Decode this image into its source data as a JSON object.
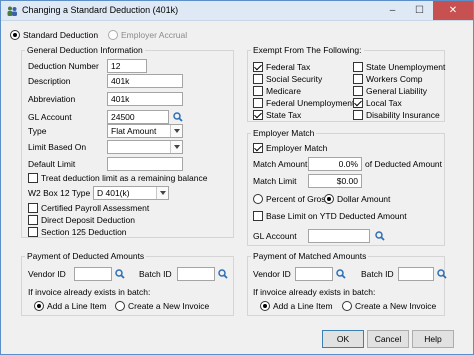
{
  "window": {
    "title": "Changing a Standard Deduction  (401k)"
  },
  "mode": {
    "standard": "Standard Deduction",
    "employer": "Employer Accrual"
  },
  "general": {
    "title": "General Deduction Information",
    "deduction_number_label": "Deduction Number",
    "deduction_number": "12",
    "description_label": "Description",
    "description": "401k",
    "abbreviation_label": "Abbreviation",
    "abbreviation": "401k",
    "gl_account_label": "GL Account",
    "gl_account": "24500",
    "type_label": "Type",
    "type": "Flat Amount",
    "limit_based_on_label": "Limit Based On",
    "limit_based_on": "",
    "default_limit_label": "Default Limit",
    "default_limit": "",
    "treat_remaining_label": "Treat deduction limit as a remaining balance",
    "w2_label": "W2 Box 12 Type",
    "w2_value": "D  401(k)",
    "certified_label": "Certified Payroll Assessment",
    "direct_deposit_label": "Direct Deposit Deduction",
    "section125_label": "Section 125 Deduction"
  },
  "exempt": {
    "title": "Exempt From The Following:",
    "items": [
      {
        "label": "Federal Tax",
        "checked": true
      },
      {
        "label": "State Unemployment",
        "checked": false
      },
      {
        "label": "Social Security",
        "checked": false
      },
      {
        "label": "Workers Comp",
        "checked": false
      },
      {
        "label": "Medicare",
        "checked": false
      },
      {
        "label": "General Liability",
        "checked": false
      },
      {
        "label": "Federal Unemployment",
        "checked": false
      },
      {
        "label": "Local Tax",
        "checked": true
      },
      {
        "label": "State Tax",
        "checked": true
      },
      {
        "label": "Disability Insurance",
        "checked": false
      }
    ]
  },
  "match": {
    "title": "Employer Match",
    "employer_match_label": "Employer Match",
    "match_amount_label": "Match Amount",
    "match_amount": "0.0%",
    "of_deducted_label": "of Deducted Amount",
    "match_limit_label": "Match Limit",
    "match_limit": "$0.00",
    "percent_gross_label": "Percent of Gross",
    "dollar_amount_label": "Dollar Amount",
    "base_limit_label": "Base Limit on YTD Deducted Amount",
    "gl_account_label": "GL Account",
    "gl_account": ""
  },
  "payment_deducted": {
    "title": "Payment of Deducted Amounts",
    "vendor_label": "Vendor ID",
    "vendor": "",
    "batch_label": "Batch ID",
    "batch": "",
    "if_exists_label": "If invoice already exists in batch:",
    "add_line_label": "Add a Line Item",
    "create_invoice_label": "Create a New Invoice"
  },
  "payment_matched": {
    "title": "Payment of Matched Amounts",
    "vendor_label": "Vendor ID",
    "vendor": "",
    "batch_label": "Batch ID",
    "batch": "",
    "if_exists_label": "If invoice already exists in batch:",
    "add_line_label": "Add a Line Item",
    "create_invoice_label": "Create a New Invoice"
  },
  "buttons": {
    "ok": "OK",
    "cancel": "Cancel",
    "help": "Help"
  },
  "colors": {
    "accent": "#3c7fb1",
    "search_icon": "#2d6fb5",
    "close": "#c75050"
  }
}
